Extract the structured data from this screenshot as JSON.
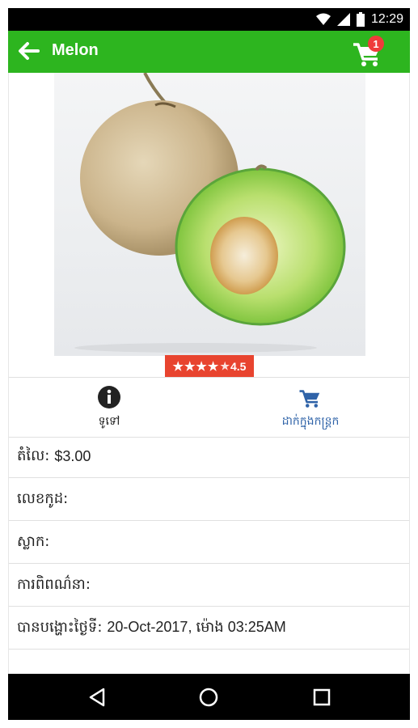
{
  "status_bar": {
    "time": "12:29",
    "icons": [
      "wifi-icon",
      "signal-icon",
      "battery-icon"
    ]
  },
  "app_bar": {
    "title": "Melon",
    "back_icon": "arrow-back-icon",
    "cart_icon": "shopping-cart-icon",
    "cart_count": "1"
  },
  "product": {
    "image": "melon-photo",
    "rating": "4.5",
    "rating_stars": "★★★★"
  },
  "actions": {
    "info_label": "ទូទៅ",
    "add_to_cart_label": "ដាក់ក្នុងកន្ត្រក"
  },
  "details": [
    {
      "label": "តំលៃ:",
      "value": "$3.00"
    },
    {
      "label": "លេខកូដ:",
      "value": ""
    },
    {
      "label": "ស្លាក:",
      "value": ""
    },
    {
      "label": "ការពិពណ៌នា:",
      "value": ""
    },
    {
      "label": "បានបង្ហោះថ្ងៃទី:",
      "value": "20-Oct-2017, ម៉ោង 03:25AM"
    }
  ],
  "colors": {
    "app_bar": "#2db51f",
    "badge": "#ef3b3b",
    "rating": "#e8442f",
    "accent": "#2f63a8"
  },
  "nav_bar": {
    "icons": [
      "back-triangle-icon",
      "home-circle-icon",
      "recents-square-icon"
    ]
  }
}
